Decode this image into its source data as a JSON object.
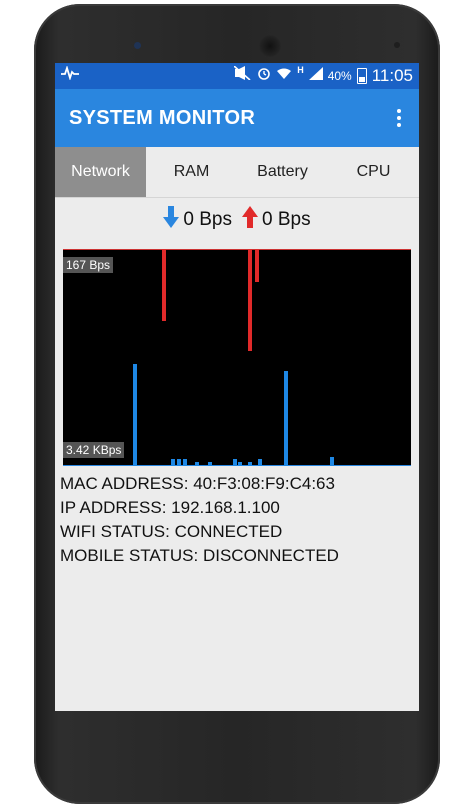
{
  "status_bar": {
    "left_icon": "pulse-icon",
    "icons": [
      "mute-icon",
      "alarm-icon",
      "wifi-icon",
      "signal-icon",
      "battery-charging-icon"
    ],
    "network_type": "H",
    "battery_percent": "40%",
    "time": "11:05"
  },
  "app": {
    "title": "SYSTEM MONITOR",
    "accent_color": "#2a86df",
    "statusbar_color": "#1a62c6"
  },
  "tabs": [
    {
      "label": "Network",
      "active": true
    },
    {
      "label": "RAM",
      "active": false
    },
    {
      "label": "Battery",
      "active": false
    },
    {
      "label": "CPU",
      "active": false
    }
  ],
  "speeds": {
    "download": "0 Bps",
    "upload": "0 Bps"
  },
  "graph": {
    "top_label": "167 Bps",
    "bottom_label": "3.42 KBps",
    "upload_color": "#e12a2a",
    "download_color": "#1e88e5",
    "upload_levels": [
      0.33,
      0.47,
      0.15
    ],
    "download_levels": [
      0.47,
      0.03,
      0.03,
      0.03,
      0.02,
      0.02,
      0.03,
      0.02,
      0.02,
      0.03,
      0.44,
      0.04
    ]
  },
  "info": {
    "mac_address": "MAC ADDRESS: 40:F3:08:F9:C4:63",
    "ip_address": "IP ADDRESS: 192.168.1.100",
    "wifi_status": "WIFI STATUS: CONNECTED",
    "mobile_status": "MOBILE STATUS: DISCONNECTED"
  }
}
